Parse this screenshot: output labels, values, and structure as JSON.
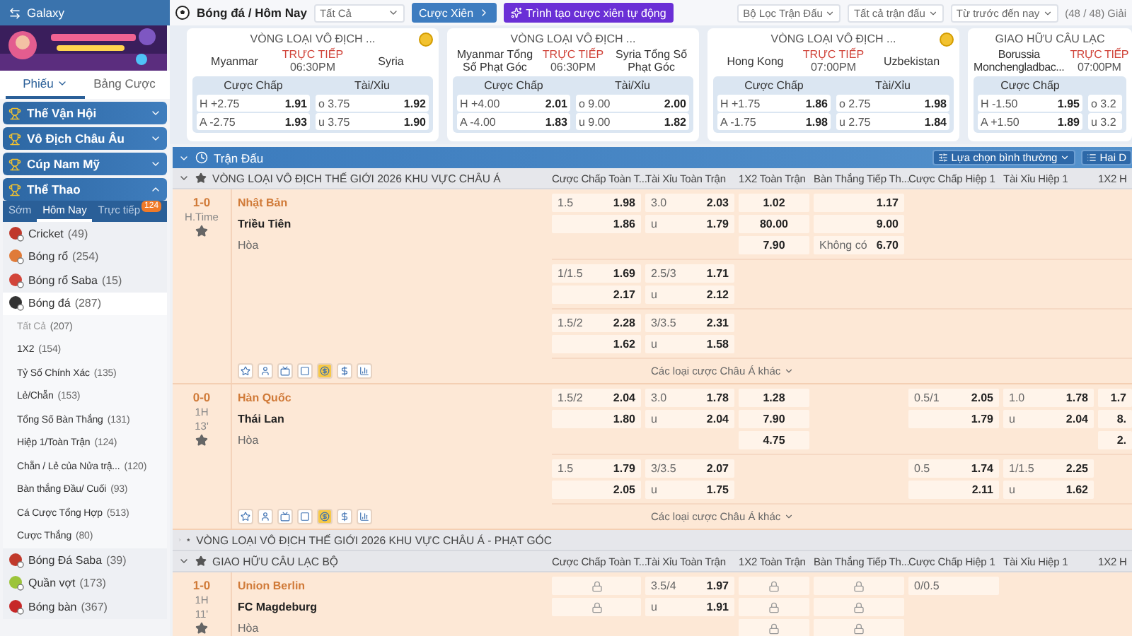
{
  "sidebar": {
    "header": "Galaxy",
    "tabs": [
      {
        "label": "Phiếu",
        "selected": true,
        "menu": true
      },
      {
        "label": "Bảng Cược",
        "selected": false,
        "menu": false
      }
    ],
    "categories": [
      {
        "label": "Thế Vận Hội",
        "expanded": false
      },
      {
        "label": "Vô Địch Châu Âu",
        "expanded": false
      },
      {
        "label": "Cúp Nam Mỹ",
        "expanded": false
      },
      {
        "label": "Thể Thao",
        "expanded": true
      }
    ],
    "time_tabs": [
      {
        "label": "Sớm",
        "selected": false
      },
      {
        "label": "Hôm Nay",
        "selected": true
      },
      {
        "label": "Trực tiếp",
        "selected": false,
        "badge": "124"
      }
    ],
    "sports": [
      {
        "label": "Cricket",
        "count": "(49)",
        "color": "#c0392b",
        "expanded": false
      },
      {
        "label": "Bóng rổ",
        "count": "(254)",
        "color": "#e07b39",
        "expanded": false
      },
      {
        "label": "Bóng rổ Saba",
        "count": "(15)",
        "color": "#d2453a",
        "expanded": false
      },
      {
        "label": "Bóng đá",
        "count": "(287)",
        "color": "#333333",
        "expanded": true,
        "children": [
          {
            "label": "Tất Cả",
            "count": "(207)",
            "selected": true
          },
          {
            "label": "1X2",
            "count": "(154)",
            "selected": false
          },
          {
            "label": "Tỷ Số Chính Xác",
            "count": "(135)",
            "selected": false
          },
          {
            "label": "Lẻ/Chẵn",
            "count": "(153)",
            "selected": false
          },
          {
            "label": "Tổng Số Bàn Thắng",
            "count": "(131)",
            "selected": false
          },
          {
            "label": "Hiệp 1/Toàn Trận",
            "count": "(124)",
            "selected": false
          },
          {
            "label": "Chẵn / Lẻ của Nửa trậ...",
            "count": "(120)",
            "selected": false
          },
          {
            "label": "Bàn thắng Đầu/ Cuối",
            "count": "(93)",
            "selected": false
          },
          {
            "label": "Cá Cược Tổng Hợp",
            "count": "(513)",
            "selected": false
          },
          {
            "label": "Cược Thắng",
            "count": "(80)",
            "selected": false
          }
        ]
      },
      {
        "label": "Bóng Đá Saba",
        "count": "(39)",
        "color": "#c0392b",
        "expanded": false
      },
      {
        "label": "Quần vợt",
        "count": "(173)",
        "color": "#9cc43a",
        "expanded": false
      },
      {
        "label": "Bóng bàn",
        "count": "(367)",
        "color": "#c62828",
        "expanded": false
      }
    ]
  },
  "topbar": {
    "title": "Bóng đá / Hôm Nay",
    "filter": "Tất Cả",
    "parlay_button": "Cược Xiên",
    "builder_button": "Trình tạo cược xiên tự động",
    "dropdowns": [
      "Bộ Lọc Trận Đấu",
      "Tất cả trận đấu",
      "Từ trước đến nay"
    ],
    "league_count": "(48 / 48) Giải"
  },
  "cards": [
    {
      "league": "VÒNG LOẠI VÔ ĐỊCH ...",
      "boosted": true,
      "home": "Myanmar",
      "status": "TRỰC TIẾP",
      "time": "06:30PM",
      "away": "Syria",
      "markets": [
        {
          "title": "Cược Chấp",
          "lines": [
            {
              "line": "H +2.75",
              "odds": "1.91"
            },
            {
              "line": "A -2.75",
              "odds": "1.93"
            }
          ]
        },
        {
          "title": "Tài/Xỉu",
          "lines": [
            {
              "line": "o 3.75",
              "odds": "1.92"
            },
            {
              "line": "u 3.75",
              "odds": "1.90"
            }
          ]
        }
      ]
    },
    {
      "league": "VÒNG LOẠI VÔ ĐỊCH ...",
      "boosted": false,
      "home": "Myanmar Tổng Số Phạt Góc",
      "status": "TRỰC TIẾP",
      "time": "06:30PM",
      "away": "Syria Tổng Số Phạt Góc",
      "markets": [
        {
          "title": "Cược Chấp",
          "lines": [
            {
              "line": "H +4.00",
              "odds": "2.01"
            },
            {
              "line": "A -4.00",
              "odds": "1.83"
            }
          ]
        },
        {
          "title": "Tài/Xỉu",
          "lines": [
            {
              "line": "o 9.00",
              "odds": "2.00"
            },
            {
              "line": "u 9.00",
              "odds": "1.82"
            }
          ]
        }
      ]
    },
    {
      "league": "VÒNG LOẠI VÔ ĐỊCH ...",
      "boosted": true,
      "home": "Hong Kong",
      "status": "TRỰC TIẾP",
      "time": "07:00PM",
      "away": "Uzbekistan",
      "markets": [
        {
          "title": "Cược Chấp",
          "lines": [
            {
              "line": "H +1.75",
              "odds": "1.86"
            },
            {
              "line": "A -1.75",
              "odds": "1.98"
            }
          ]
        },
        {
          "title": "Tài/Xỉu",
          "lines": [
            {
              "line": "o 2.75",
              "odds": "1.98"
            },
            {
              "line": "u 2.75",
              "odds": "1.84"
            }
          ]
        }
      ]
    },
    {
      "league": "GIAO HỮU CÂU LẠC",
      "boosted": false,
      "home": "Borussia Monchengladbac...",
      "status": "TRỰC TIẾP",
      "time": "07:00PM",
      "markets": [
        {
          "title": "Cược Chấp",
          "lines": [
            {
              "line": "H -1.50",
              "odds": "1.95"
            },
            {
              "line": "A +1.50",
              "odds": "1.89"
            }
          ]
        },
        {
          "lines": [
            {
              "line": "o 3.2"
            },
            {
              "line": "u 3.2"
            }
          ]
        }
      ]
    }
  ],
  "section": {
    "title": "Trận Đấu",
    "view_select": "Lựa chọn bình thường",
    "layout_button": "Hai D"
  },
  "leagues": [
    {
      "name": "VÒNG LOẠI VÔ ĐỊCH THẾ GIỚI 2026 KHU VỰC CHÂU Á",
      "expanded": true,
      "columns": [
        "Cược Chấp Toàn T...",
        "Tài Xỉu Toàn Trận",
        "1X2 Toàn Trận",
        "Bàn Thắng Tiếp Th...",
        "Cược Chấp Hiệp 1",
        "Tài Xỉu Hiệp 1",
        "1X2 H"
      ],
      "matches": [
        {
          "score": "1-0",
          "clock": [
            "H.Time"
          ],
          "teams": [
            {
              "name": "Nhật Bản",
              "favorite": true
            },
            {
              "name": "Triều Tiên",
              "favorite": false
            }
          ],
          "draw": "Hòa",
          "more_markets": "Các loại cược Châu Á khác",
          "groups": [
            [
              {
                "handicap": {
                  "line": "1.5",
                  "odds": "1.98"
                },
                "total": {
                  "line": "3.0",
                  "odds": "2.03"
                },
                "result": {
                  "odds": "1.02"
                },
                "next_goal": {
                  "odds": "1.17"
                }
              },
              {
                "handicap": {
                  "odds": "1.86"
                },
                "total": {
                  "line": "u",
                  "odds": "1.79"
                },
                "result": {
                  "odds": "80.00"
                },
                "next_goal": {
                  "odds": "9.00"
                }
              },
              {
                "result": {
                  "odds": "7.90"
                },
                "next_goal": {
                  "line": "Không có",
                  "odds": "6.70"
                }
              }
            ],
            [
              {
                "handicap": {
                  "line": "1/1.5",
                  "odds": "1.69"
                },
                "total": {
                  "line": "2.5/3",
                  "odds": "1.71"
                }
              },
              {
                "handicap": {
                  "odds": "2.17"
                },
                "total": {
                  "line": "u",
                  "odds": "2.12"
                }
              }
            ],
            [
              {
                "handicap": {
                  "line": "1.5/2",
                  "odds": "2.28"
                },
                "total": {
                  "line": "3/3.5",
                  "odds": "2.31"
                }
              },
              {
                "handicap": {
                  "odds": "1.62"
                },
                "total": {
                  "line": "u",
                  "odds": "1.58"
                }
              }
            ]
          ]
        },
        {
          "score": "0-0",
          "clock": [
            "1H",
            "13'"
          ],
          "teams": [
            {
              "name": "Hàn Quốc",
              "favorite": true
            },
            {
              "name": "Thái Lan",
              "favorite": false
            }
          ],
          "draw": "Hòa",
          "more_markets": "Các loại cược Châu Á khác",
          "groups": [
            [
              {
                "handicap": {
                  "line": "1.5/2",
                  "odds": "2.04"
                },
                "total": {
                  "line": "3.0",
                  "odds": "1.78"
                },
                "result": {
                  "odds": "1.28"
                },
                "handicap_1h": {
                  "line": "0.5/1",
                  "odds": "2.05"
                },
                "total_1h": {
                  "line": "1.0",
                  "odds": "1.78"
                },
                "result_1h": {
                  "odds": "1.7"
                }
              },
              {
                "handicap": {
                  "odds": "1.80"
                },
                "total": {
                  "line": "u",
                  "odds": "2.04"
                },
                "result": {
                  "odds": "7.90"
                },
                "handicap_1h": {
                  "odds": "1.79"
                },
                "total_1h": {
                  "line": "u",
                  "odds": "2.04"
                },
                "result_1h": {
                  "odds": "8."
                }
              },
              {
                "result": {
                  "odds": "4.75"
                },
                "result_1h": {
                  "odds": "2."
                }
              }
            ],
            [
              {
                "handicap": {
                  "line": "1.5",
                  "odds": "1.79"
                },
                "total": {
                  "line": "3/3.5",
                  "odds": "2.07"
                },
                "handicap_1h": {
                  "line": "0.5",
                  "odds": "1.74"
                },
                "total_1h": {
                  "line": "1/1.5",
                  "odds": "2.25"
                }
              },
              {
                "handicap": {
                  "odds": "2.05"
                },
                "total": {
                  "line": "u",
                  "odds": "1.75"
                },
                "handicap_1h": {
                  "odds": "2.11"
                },
                "total_1h": {
                  "line": "u",
                  "odds": "1.62"
                }
              }
            ]
          ]
        }
      ]
    },
    {
      "name": "VÒNG LOẠI VÔ ĐỊCH THẾ GIỚI 2026 KHU VỰC CHÂU Á - PHẠT GÓC",
      "expanded": false
    },
    {
      "name": "GIAO HỮU CÂU LẠC BỘ",
      "expanded": true,
      "columns": [
        "Cược Chấp Toàn T...",
        "Tài Xỉu Toàn Trận",
        "1X2 Toàn Trận",
        "Bàn Thắng Tiếp Th...",
        "Cược Chấp Hiệp 1",
        "Tài Xỉu Hiệp 1",
        "1X2 H"
      ],
      "matches": [
        {
          "score": "1-0",
          "clock": [
            "1H",
            "11'"
          ],
          "teams": [
            {
              "name": "Union Berlin",
              "favorite": true
            },
            {
              "name": "FC Magdeburg",
              "favorite": false
            }
          ],
          "draw": "Hòa",
          "groups": [
            [
              {
                "handicap": {
                  "locked": true
                },
                "total": {
                  "line": "3.5/4",
                  "odds": "1.97"
                },
                "result": {
                  "locked": true
                },
                "next_goal": {
                  "locked": true
                },
                "handicap_1h": {
                  "line": "0/0.5"
                }
              },
              {
                "handicap": {
                  "locked": true
                },
                "total": {
                  "line": "u",
                  "odds": "1.91"
                },
                "result": {
                  "locked": true
                },
                "next_goal": {
                  "locked": true
                }
              },
              {
                "result": {
                  "locked": true
                },
                "next_goal": {
                  "locked": true
                }
              }
            ]
          ]
        }
      ]
    }
  ]
}
